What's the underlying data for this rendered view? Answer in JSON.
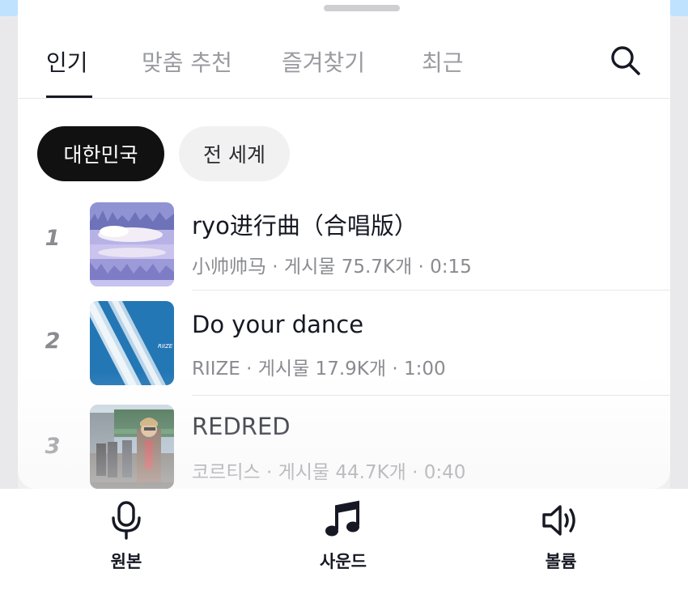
{
  "tabs": [
    {
      "label": "인기",
      "active": true
    },
    {
      "label": "맞춤 추천",
      "active": false
    },
    {
      "label": "즐겨찾기",
      "active": false
    },
    {
      "label": "최근",
      "active": false
    }
  ],
  "search": {
    "icon": "search-icon"
  },
  "regions": [
    {
      "label": "대한민국",
      "selected": true
    },
    {
      "label": "전 세계",
      "selected": false
    }
  ],
  "songs": [
    {
      "rank": "1",
      "title": "ryo进行曲（合唱版）",
      "meta": "小帅帅马 · 게시물 75.7K개 · 0:15"
    },
    {
      "rank": "2",
      "title": "Do your dance",
      "meta": "RIIZE · 게시물 17.9K개 · 1:00"
    },
    {
      "rank": "3",
      "title": "REDRED",
      "meta": "코르티스 · 게시물 44.7K개 · 0:40"
    }
  ],
  "bottom_bar": [
    {
      "label": "원본",
      "icon": "microphone-icon"
    },
    {
      "label": "사운드",
      "icon": "music-note-icon"
    },
    {
      "label": "볼륨",
      "icon": "speaker-volume-icon"
    }
  ],
  "colors": {
    "text": "#161823",
    "muted": "#8a8b90",
    "chip_selected": "#111111",
    "chip_bg": "#f1f1f2"
  }
}
